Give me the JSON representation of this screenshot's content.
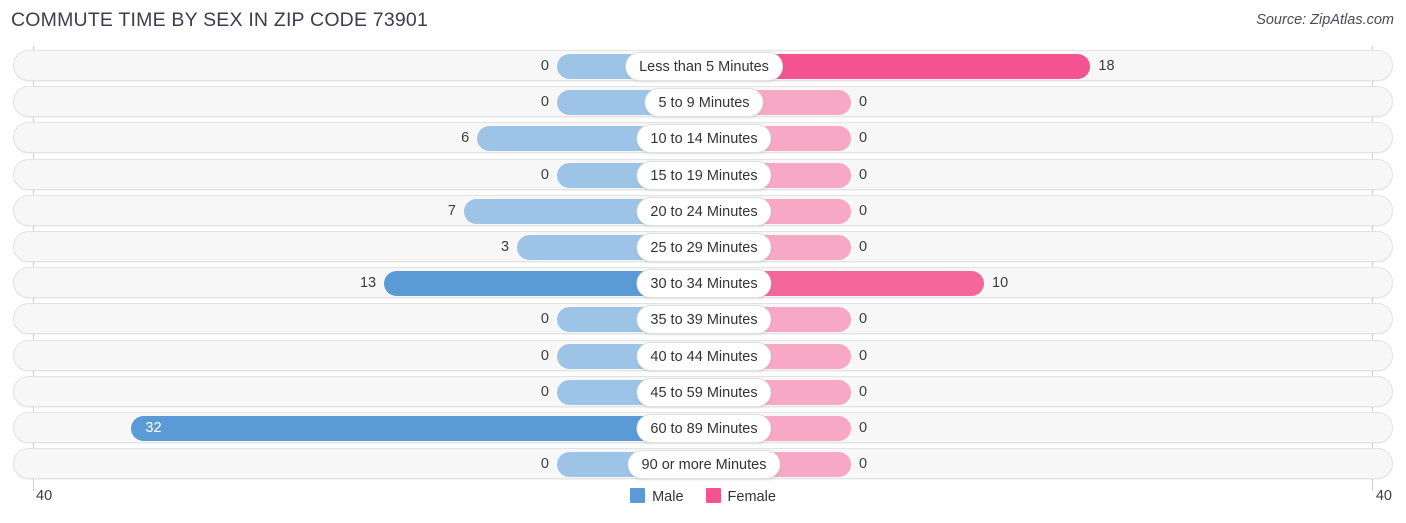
{
  "header": {
    "title": "COMMUTE TIME BY SEX IN ZIP CODE 73901",
    "source": "Source: ZipAtlas.com"
  },
  "axis": {
    "left_tick": "40",
    "right_tick": "40"
  },
  "legend": {
    "items": [
      {
        "label": "Male",
        "color": "#5b9bd5"
      },
      {
        "label": "Female",
        "color": "#f4538f"
      }
    ]
  },
  "chart_data": {
    "type": "bar",
    "orientation": "horizontal-diverging",
    "title": "COMMUTE TIME BY SEX IN ZIP CODE 73901",
    "source": "Source: ZipAtlas.com",
    "xlabel": "",
    "ylabel": "",
    "xlim": [
      40,
      40
    ],
    "axis_left_max": 40,
    "axis_right_max": 40,
    "grid": false,
    "legend_position": "bottom-center",
    "categories": [
      "Less than 5 Minutes",
      "5 to 9 Minutes",
      "10 to 14 Minutes",
      "15 to 19 Minutes",
      "20 to 24 Minutes",
      "25 to 29 Minutes",
      "30 to 34 Minutes",
      "35 to 39 Minutes",
      "40 to 44 Minutes",
      "45 to 59 Minutes",
      "60 to 89 Minutes",
      "90 or more Minutes"
    ],
    "series": [
      {
        "name": "Male",
        "color": "#5b9bd5",
        "values": [
          0,
          0,
          6,
          0,
          7,
          3,
          13,
          0,
          0,
          0,
          32,
          0
        ]
      },
      {
        "name": "Female",
        "color": "#f4538f",
        "values": [
          18,
          0,
          0,
          0,
          0,
          0,
          10,
          0,
          0,
          0,
          0,
          0
        ]
      }
    ],
    "rows": [
      {
        "category": "Less than 5 Minutes",
        "male": 0,
        "female": 18,
        "male_label": "0",
        "female_label": "18"
      },
      {
        "category": "5 to 9 Minutes",
        "male": 0,
        "female": 0,
        "male_label": "0",
        "female_label": "0"
      },
      {
        "category": "10 to 14 Minutes",
        "male": 6,
        "female": 0,
        "male_label": "6",
        "female_label": "0"
      },
      {
        "category": "15 to 19 Minutes",
        "male": 0,
        "female": 0,
        "male_label": "0",
        "female_label": "0"
      },
      {
        "category": "20 to 24 Minutes",
        "male": 7,
        "female": 0,
        "male_label": "7",
        "female_label": "0"
      },
      {
        "category": "25 to 29 Minutes",
        "male": 3,
        "female": 0,
        "male_label": "3",
        "female_label": "0"
      },
      {
        "category": "30 to 34 Minutes",
        "male": 13,
        "female": 10,
        "male_label": "13",
        "female_label": "10"
      },
      {
        "category": "35 to 39 Minutes",
        "male": 0,
        "female": 0,
        "male_label": "0",
        "female_label": "0"
      },
      {
        "category": "40 to 44 Minutes",
        "male": 0,
        "female": 0,
        "male_label": "0",
        "female_label": "0"
      },
      {
        "category": "45 to 59 Minutes",
        "male": 0,
        "female": 0,
        "male_label": "0",
        "female_label": "0"
      },
      {
        "category": "60 to 89 Minutes",
        "male": 32,
        "female": 0,
        "male_label": "32",
        "female_label": "0"
      },
      {
        "category": "90 or more Minutes",
        "male": 0,
        "female": 0,
        "male_label": "0",
        "female_label": "0"
      }
    ]
  }
}
